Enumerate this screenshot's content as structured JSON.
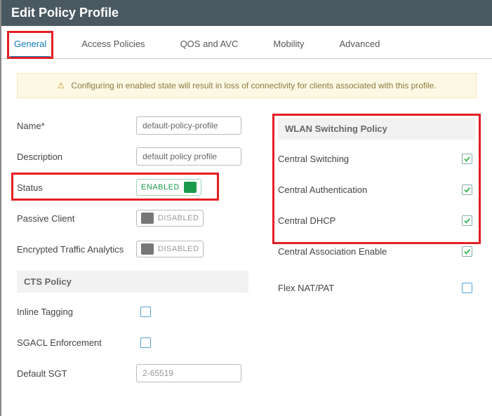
{
  "title": "Edit Policy Profile",
  "tabs": {
    "t0": "General",
    "t1": "Access Policies",
    "t2": "QOS and AVC",
    "t3": "Mobility",
    "t4": "Advanced"
  },
  "alert": "Configuring in enabled state will result in loss of connectivity for clients associated with this profile.",
  "left": {
    "name_label": "Name*",
    "name_value": "default-policy-profile",
    "desc_label": "Description",
    "desc_value": "default policy profile",
    "status_label": "Status",
    "status_value": "ENABLED",
    "passive_label": "Passive Client",
    "passive_value": "DISABLED",
    "eta_label": "Encrypted Traffic Analytics",
    "eta_value": "DISABLED",
    "cts_head": "CTS Policy",
    "inline_label": "Inline Tagging",
    "sgacl_label": "SGACL Enforcement",
    "sgt_label": "Default SGT",
    "sgt_placeholder": "2-65519"
  },
  "right": {
    "head": "WLAN Switching Policy",
    "r0": "Central Switching",
    "r1": "Central Authentication",
    "r2": "Central DHCP",
    "r3": "Central Association Enable",
    "r4": "Flex NAT/PAT"
  }
}
